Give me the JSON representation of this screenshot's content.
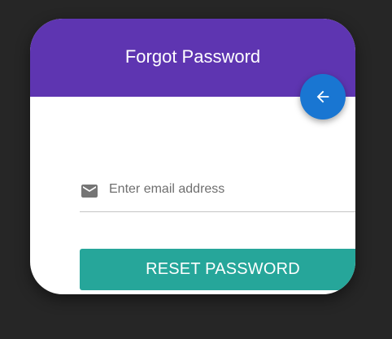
{
  "colors": {
    "page_background": "#262626",
    "header": "#5e35b1",
    "fab": "#1976d2",
    "button": "#26a69a",
    "icon": "#757575"
  },
  "header": {
    "title": "Forgot Password"
  },
  "back_button": {
    "icon": "arrow-left-icon"
  },
  "email_field": {
    "icon": "mail-icon",
    "value": "",
    "placeholder": "Enter email address"
  },
  "reset_button": {
    "label": "RESET PASSWORD"
  }
}
